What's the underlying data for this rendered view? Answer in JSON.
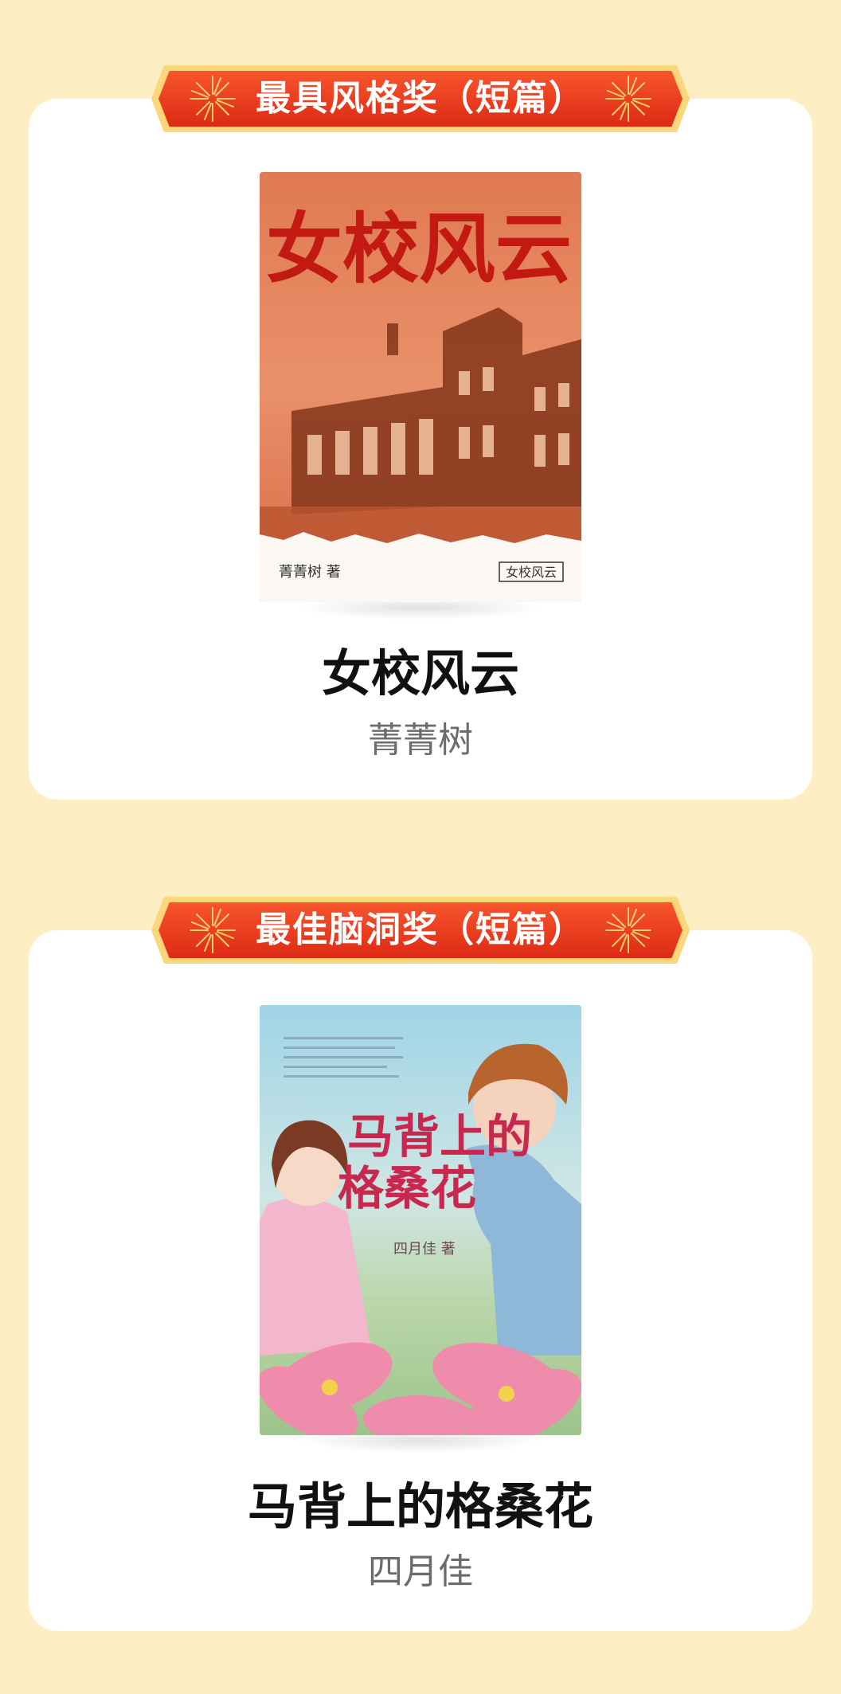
{
  "awards": [
    {
      "title": "最具风格奖（短篇）",
      "book": {
        "title": "女校风云",
        "author": "菁菁树",
        "cover": {
          "calligraphy": "女校风云",
          "author_line": "菁菁树 著",
          "stamp": "女校风云"
        }
      }
    },
    {
      "title": "最佳脑洞奖（短篇）",
      "book": {
        "title": "马背上的格桑花",
        "author": "四月佳",
        "cover": {
          "calligraphy_top": "马背上的",
          "calligraphy_bottom": "格桑花",
          "author_line": "四月佳 著"
        }
      }
    }
  ],
  "colors": {
    "page_bg": "#fdeec4",
    "card_bg": "#ffffff",
    "ribbon_red": "#e8321c",
    "ribbon_gold": "#f7c35a"
  },
  "icons": {
    "ribbon_left": "firework-icon",
    "ribbon_right": "firework-icon"
  }
}
